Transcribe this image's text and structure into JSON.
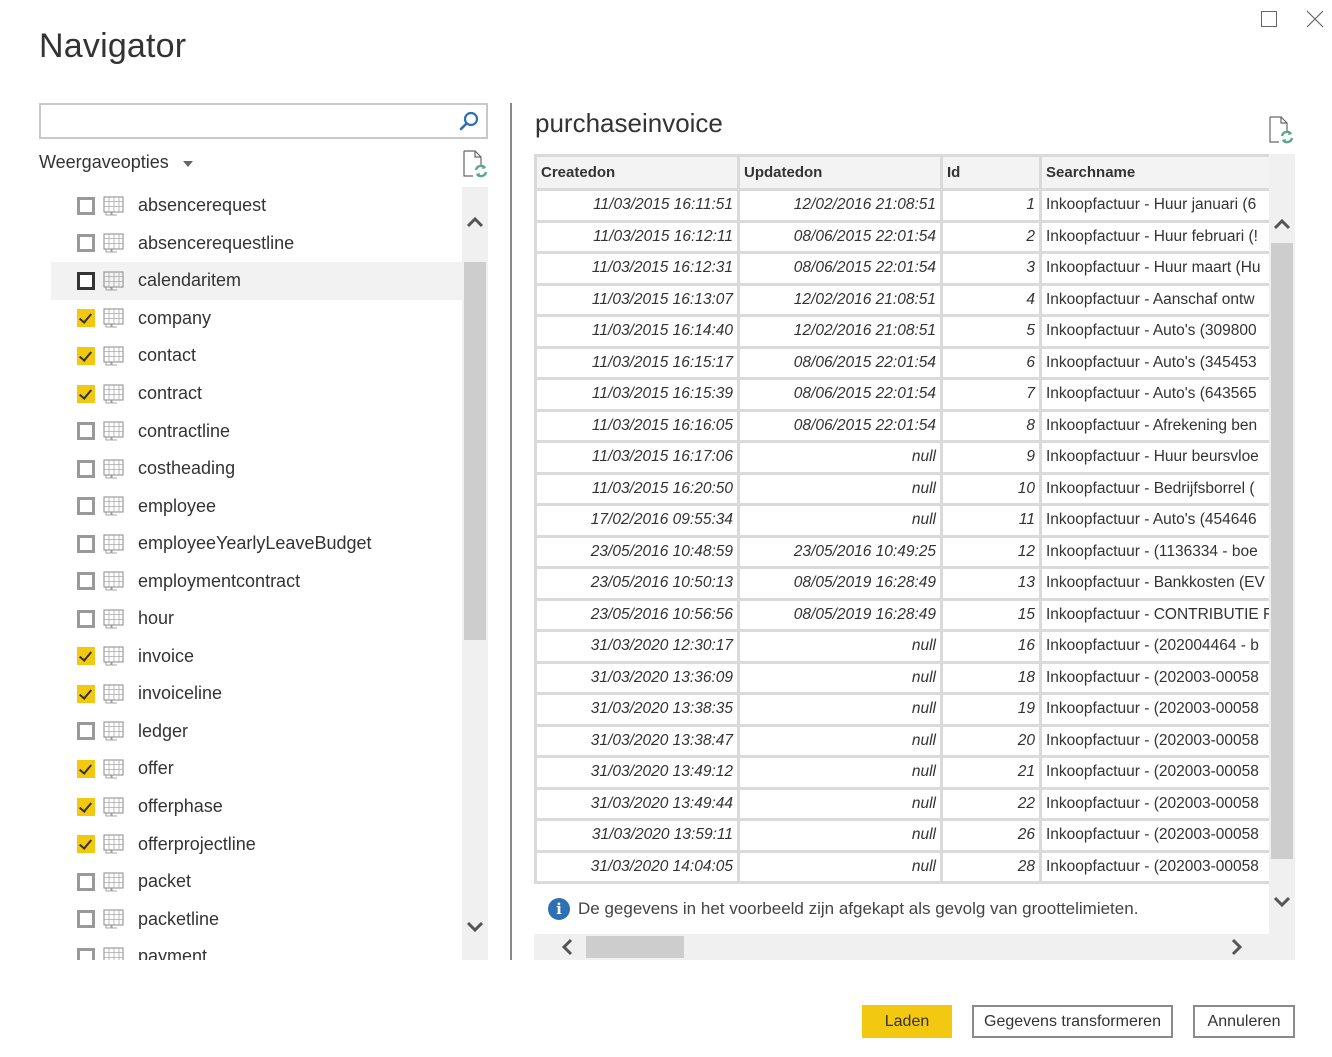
{
  "window": {
    "title": "Navigator",
    "maximize_icon": "maximize-icon",
    "close_icon": "close-icon"
  },
  "left_pane": {
    "search": {
      "value": "",
      "placeholder": "",
      "icon": "search-icon"
    },
    "view_options_label": "Weergaveopties",
    "refresh_icon": "refresh-file-icon",
    "items": [
      {
        "label": "absencerequest",
        "checked": false
      },
      {
        "label": "absencerequestline",
        "checked": false
      },
      {
        "label": "calendaritem",
        "checked": false,
        "hovered": true
      },
      {
        "label": "company",
        "checked": true
      },
      {
        "label": "contact",
        "checked": true
      },
      {
        "label": "contract",
        "checked": true
      },
      {
        "label": "contractline",
        "checked": false
      },
      {
        "label": "costheading",
        "checked": false
      },
      {
        "label": "employee",
        "checked": false
      },
      {
        "label": "employeeYearlyLeaveBudget",
        "checked": false
      },
      {
        "label": "employmentcontract",
        "checked": false
      },
      {
        "label": "hour",
        "checked": false
      },
      {
        "label": "invoice",
        "checked": true
      },
      {
        "label": "invoiceline",
        "checked": true
      },
      {
        "label": "ledger",
        "checked": false
      },
      {
        "label": "offer",
        "checked": true
      },
      {
        "label": "offerphase",
        "checked": true
      },
      {
        "label": "offerprojectline",
        "checked": true
      },
      {
        "label": "packet",
        "checked": false
      },
      {
        "label": "packetline",
        "checked": false
      },
      {
        "label": "payment",
        "checked": false
      }
    ]
  },
  "preview": {
    "title": "purchaseinvoice",
    "refresh_icon": "refresh-file-icon",
    "columns": [
      "Createdon",
      "Updatedon",
      "Id",
      "Searchname"
    ],
    "rows": [
      [
        "11/03/2015 16:11:51",
        "12/02/2016 21:08:51",
        "1",
        "Inkoopfactuur - Huur januari (6"
      ],
      [
        "11/03/2015 16:12:11",
        "08/06/2015 22:01:54",
        "2",
        "Inkoopfactuur - Huur februari (!"
      ],
      [
        "11/03/2015 16:12:31",
        "08/06/2015 22:01:54",
        "3",
        "Inkoopfactuur - Huur maart (Hu"
      ],
      [
        "11/03/2015 16:13:07",
        "12/02/2016 21:08:51",
        "4",
        "Inkoopfactuur - Aanschaf ontw"
      ],
      [
        "11/03/2015 16:14:40",
        "12/02/2016 21:08:51",
        "5",
        "Inkoopfactuur - Auto's (309800"
      ],
      [
        "11/03/2015 16:15:17",
        "08/06/2015 22:01:54",
        "6",
        "Inkoopfactuur - Auto's (345453"
      ],
      [
        "11/03/2015 16:15:39",
        "08/06/2015 22:01:54",
        "7",
        "Inkoopfactuur - Auto's (643565"
      ],
      [
        "11/03/2015 16:16:05",
        "08/06/2015 22:01:54",
        "8",
        "Inkoopfactuur - Afrekening ben"
      ],
      [
        "11/03/2015 16:17:06",
        "null",
        "9",
        "Inkoopfactuur - Huur beursvloe"
      ],
      [
        "11/03/2015 16:20:50",
        "null",
        "10",
        "Inkoopfactuur - Bedrijfsborrel ("
      ],
      [
        "17/02/2016 09:55:34",
        "null",
        "11",
        "Inkoopfactuur - Auto's (454646"
      ],
      [
        "23/05/2016 10:48:59",
        "23/05/2016 10:49:25",
        "12",
        "Inkoopfactuur - (1136334 - boe"
      ],
      [
        "23/05/2016 10:50:13",
        "08/05/2019 16:28:49",
        "13",
        "Inkoopfactuur - Bankkosten (EV"
      ],
      [
        "23/05/2016 10:56:56",
        "08/05/2019 16:28:49",
        "15",
        "Inkoopfactuur - CONTRIBUTIE F"
      ],
      [
        "31/03/2020 12:30:17",
        "null",
        "16",
        "Inkoopfactuur - (202004464 - b"
      ],
      [
        "31/03/2020 13:36:09",
        "null",
        "18",
        "Inkoopfactuur - (202003-00058"
      ],
      [
        "31/03/2020 13:38:35",
        "null",
        "19",
        "Inkoopfactuur - (202003-00058"
      ],
      [
        "31/03/2020 13:38:47",
        "null",
        "20",
        "Inkoopfactuur - (202003-00058"
      ],
      [
        "31/03/2020 13:49:12",
        "null",
        "21",
        "Inkoopfactuur - (202003-00058"
      ],
      [
        "31/03/2020 13:49:44",
        "null",
        "22",
        "Inkoopfactuur - (202003-00058"
      ],
      [
        "31/03/2020 13:59:11",
        "null",
        "26",
        "Inkoopfactuur - (202003-00058"
      ],
      [
        "31/03/2020 14:04:05",
        "null",
        "28",
        "Inkoopfactuur - (202003-00058"
      ]
    ],
    "truncation_notice": "De gegevens in het voorbeeld zijn afgekapt als gevolg van groottelimieten.",
    "info_icon": "info-icon"
  },
  "buttons": {
    "load": "Laden",
    "transform": "Gegevens transformeren",
    "cancel": "Annuleren"
  },
  "colors": {
    "accent": "#f2c811",
    "info": "#2f6fb4",
    "refresh_green": "#5aa88a"
  }
}
